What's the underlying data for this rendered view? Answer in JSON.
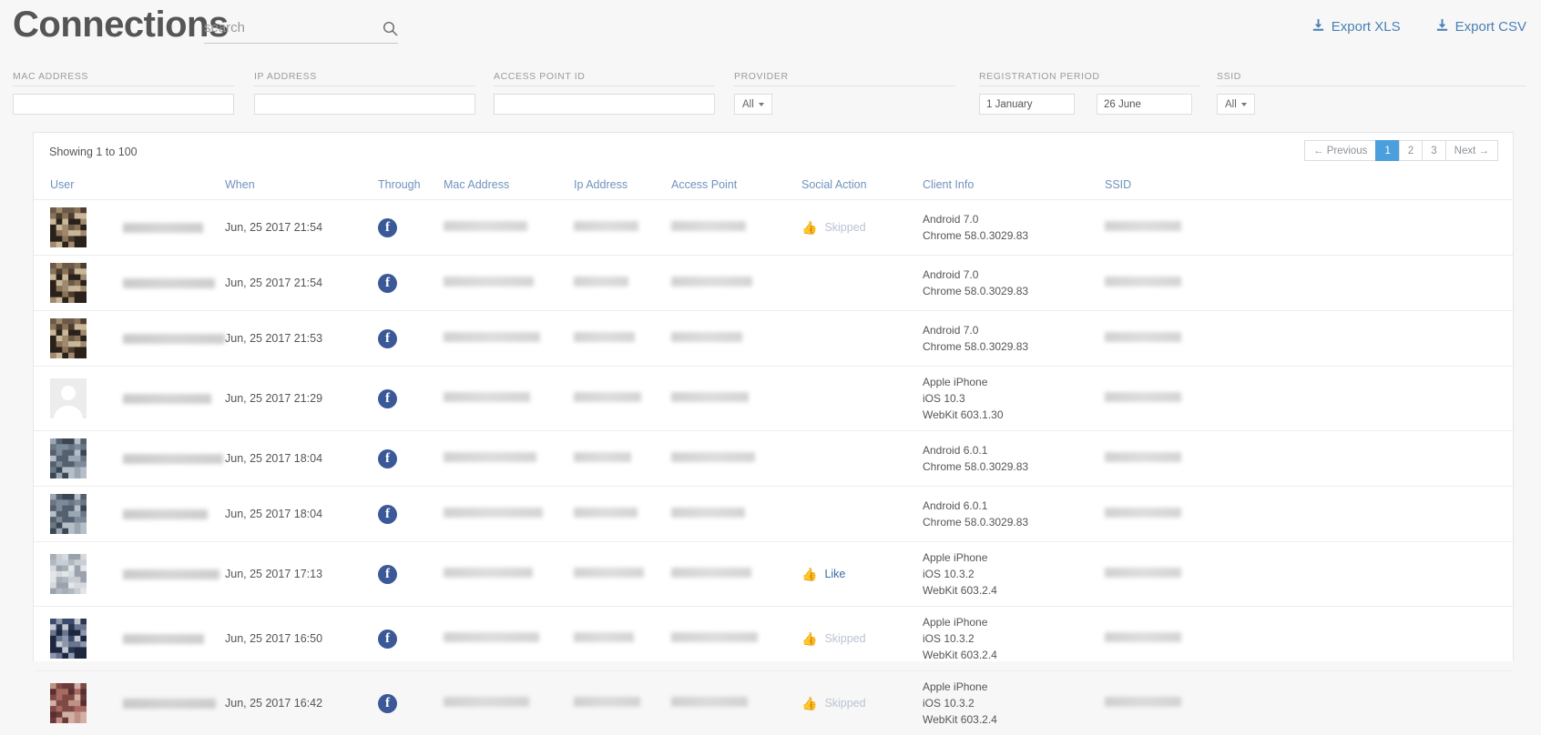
{
  "header": {
    "title": "Connections",
    "search_placeholder": "search",
    "search_value": "",
    "search_icon": "search-icon",
    "export_xls": "Export XLS",
    "export_csv": "Export CSV",
    "download_icon": "download-icon"
  },
  "filters": [
    {
      "label": "MAC ADDRESS",
      "type": "text",
      "value": ""
    },
    {
      "label": "IP ADDRESS",
      "type": "text",
      "value": ""
    },
    {
      "label": "ACCESS POINT ID",
      "type": "text",
      "value": ""
    },
    {
      "label": "PROVIDER",
      "type": "select",
      "value": "All"
    },
    {
      "label": "REGISTRATION PERIOD",
      "type": "daterange",
      "from": "1 January",
      "to": "26 June"
    },
    {
      "label": "SSID",
      "type": "select",
      "value": "All"
    }
  ],
  "table": {
    "showing": "Showing 1 to 100",
    "pagination": {
      "previous": "← Previous",
      "pages": [
        "1",
        "2",
        "3"
      ],
      "active_page": "1",
      "next": "Next →"
    },
    "columns": [
      "User",
      "When",
      "Through",
      "Mac Address",
      "Ip Address",
      "Access Point",
      "Social Action",
      "Client Info",
      "SSID"
    ],
    "rows": [
      {
        "user": "[redacted]",
        "when": "Jun, 25 2017 21:54",
        "through": "facebook-icon",
        "mac": "[redacted]",
        "ip": "[redacted]",
        "access_point": "[redacted]",
        "social_action": "Skipped",
        "social_state": "skipped",
        "client_info": "Android 7.0\nChrome 58.0.3029.83",
        "ssid": "[redacted]",
        "avatar_kind": "photo-dark"
      },
      {
        "user": "[redacted]",
        "when": "Jun, 25 2017 21:54",
        "through": "facebook-icon",
        "mac": "[redacted]",
        "ip": "[redacted]",
        "access_point": "[redacted]",
        "social_action": "",
        "social_state": "none",
        "client_info": "Android 7.0\nChrome 58.0.3029.83",
        "ssid": "[redacted]",
        "avatar_kind": "photo-dark"
      },
      {
        "user": "[redacted]",
        "when": "Jun, 25 2017 21:53",
        "through": "facebook-icon",
        "mac": "[redacted]",
        "ip": "[redacted]",
        "access_point": "[redacted]",
        "social_action": "",
        "social_state": "none",
        "client_info": "Android 7.0\nChrome 58.0.3029.83",
        "ssid": "[redacted]",
        "avatar_kind": "photo-dark"
      },
      {
        "user": "[redacted]",
        "when": "Jun, 25 2017 21:29",
        "through": "facebook-icon",
        "mac": "[redacted]",
        "ip": "[redacted]",
        "access_point": "[redacted]",
        "social_action": "",
        "social_state": "none",
        "client_info": "Apple iPhone\niOS 10.3\nWebKit 603.1.30",
        "ssid": "[redacted]",
        "avatar_kind": "silhouette"
      },
      {
        "user": "[redacted]",
        "when": "Jun, 25 2017 18:04",
        "through": "facebook-icon",
        "mac": "[redacted]",
        "ip": "[redacted]",
        "access_point": "[redacted]",
        "social_action": "",
        "social_state": "none",
        "client_info": "Android 6.0.1\nChrome 58.0.3029.83",
        "ssid": "[redacted]",
        "avatar_kind": "photo-mid"
      },
      {
        "user": "[redacted]",
        "when": "Jun, 25 2017 18:04",
        "through": "facebook-icon",
        "mac": "[redacted]",
        "ip": "[redacted]",
        "access_point": "[redacted]",
        "social_action": "",
        "social_state": "none",
        "client_info": "Android 6.0.1\nChrome 58.0.3029.83",
        "ssid": "[redacted]",
        "avatar_kind": "photo-mid"
      },
      {
        "user": "[redacted]",
        "when": "Jun, 25 2017 17:13",
        "through": "facebook-icon",
        "mac": "[redacted]",
        "ip": "[redacted]",
        "access_point": "[redacted]",
        "social_action": "Like",
        "social_state": "like",
        "client_info": "Apple iPhone\niOS 10.3.2\nWebKit 603.2.4",
        "ssid": "[redacted]",
        "avatar_kind": "photo-light"
      },
      {
        "user": "[redacted]",
        "when": "Jun, 25 2017 16:50",
        "through": "facebook-icon",
        "mac": "[redacted]",
        "ip": "[redacted]",
        "access_point": "[redacted]",
        "social_action": "Skipped",
        "social_state": "skipped",
        "client_info": "Apple iPhone\niOS 10.3.2\nWebKit 603.2.4",
        "ssid": "[redacted]",
        "avatar_kind": "photo-blue"
      },
      {
        "user": "[redacted]",
        "when": "Jun, 25 2017 16:42",
        "through": "facebook-icon",
        "mac": "[redacted]",
        "ip": "[redacted]",
        "access_point": "[redacted]",
        "social_action": "Skipped",
        "social_state": "skipped",
        "client_info": "Apple iPhone\niOS 10.3.2\nWebKit 603.2.4",
        "ssid": "[redacted]",
        "avatar_kind": "photo-red"
      }
    ]
  },
  "colors": {
    "accent": "#4a9fdc",
    "link": "#4a7fb5",
    "header_text": "#6f92bd",
    "facebook": "#3b5998",
    "skipped": "#b9c4d3",
    "page_bg": "#f7f7f7"
  }
}
